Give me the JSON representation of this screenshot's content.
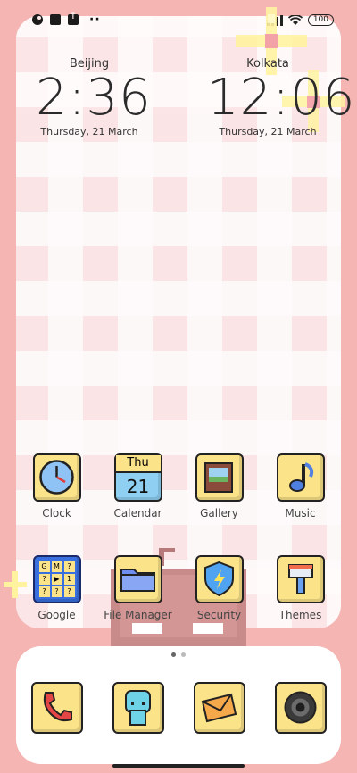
{
  "status_bar": {
    "battery": "100",
    "icons": [
      "mi-icon",
      "square-icon",
      "upload-icon",
      "more-dots-icon",
      "signal-icon",
      "wifi-icon",
      "battery-icon"
    ]
  },
  "clocks": [
    {
      "city": "Beijing",
      "time": "2:36",
      "date": "Thursday, 21 March"
    },
    {
      "city": "Kolkata",
      "time": "12:06",
      "date": "Thursday, 21 March"
    }
  ],
  "apps_row1": [
    {
      "label": "Clock",
      "icon": "clock-icon"
    },
    {
      "label": "Calendar",
      "icon": "calendar-icon",
      "cal_day": "Thu",
      "cal_date": "21"
    },
    {
      "label": "Gallery",
      "icon": "gallery-icon"
    },
    {
      "label": "Music",
      "icon": "music-icon"
    }
  ],
  "apps_row2": [
    {
      "label": "Google",
      "icon": "google-folder-icon",
      "folder_glyphs": [
        "G",
        "M",
        "?",
        "?",
        "▶",
        "1",
        "?",
        "?",
        "?"
      ]
    },
    {
      "label": "File Manager",
      "icon": "folder-icon"
    },
    {
      "label": "Security",
      "icon": "shield-icon"
    },
    {
      "label": "Themes",
      "icon": "paintbrush-icon"
    }
  ],
  "dock": [
    {
      "icon": "phone-icon"
    },
    {
      "icon": "contacts-icon"
    },
    {
      "icon": "messages-icon"
    },
    {
      "icon": "camera-icon"
    }
  ],
  "pager": {
    "pages": 2,
    "active": 0
  },
  "colors": {
    "background": "#f5b5b3",
    "card": "#fbe9ea",
    "tile": "#fbe38a",
    "accent_yellow": "#fff08a"
  }
}
